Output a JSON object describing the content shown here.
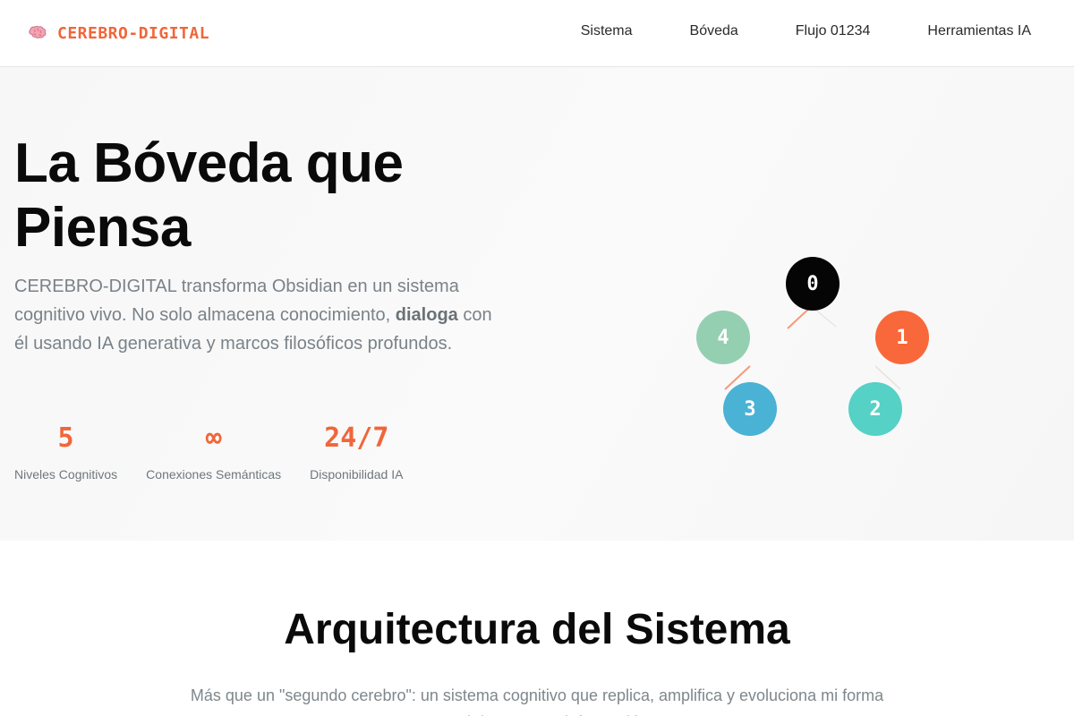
{
  "header": {
    "brand_icon": "brain-icon",
    "brand_name": "CEREBRO-DIGITAL",
    "accent_color": "#f0663a",
    "nav": [
      {
        "label": "Sistema"
      },
      {
        "label": "Bóveda"
      },
      {
        "label": "Flujo 01234"
      },
      {
        "label": "Herramientas IA"
      }
    ]
  },
  "hero": {
    "title_line1": "La Bóveda que",
    "title_line2": "Piensa",
    "desc_part1": "CEREBRO-DIGITAL transforma Obsidian en un sistema cognitivo vivo. No solo almacena conocimiento, ",
    "desc_bold": "dialoga",
    "desc_part2": " con él usando IA generativa y marcos filosóficos profundos.",
    "stats": [
      {
        "value": "5",
        "label": "Niveles Cognitivos"
      },
      {
        "value": "∞",
        "label": "Conexiones Semánticas"
      },
      {
        "value": "24/7",
        "label": "Disponibilidad IA"
      }
    ]
  },
  "network": {
    "nodes": [
      {
        "label": "0",
        "color": "#050505"
      },
      {
        "label": "1",
        "color": "#f9683a"
      },
      {
        "label": "2",
        "color": "#55d1c6"
      },
      {
        "label": "3",
        "color": "#4ab2d4"
      },
      {
        "label": "4",
        "color": "#94cfb1"
      }
    ]
  },
  "section": {
    "title": "Arquitectura del Sistema",
    "desc": "Más que un \"segundo cerebro\": un sistema cognitivo que replica, amplifica y evoluciona mi forma natural de procesar información."
  }
}
